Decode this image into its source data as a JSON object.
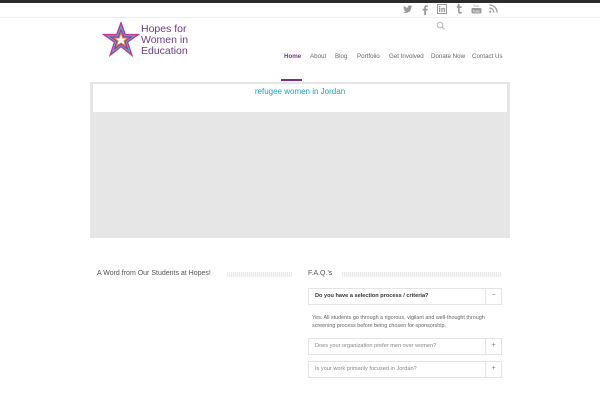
{
  "social_icons": [
    "twitter-icon",
    "facebook-icon",
    "linkedin-icon",
    "tumblr-icon",
    "youtube-icon",
    "rss-icon"
  ],
  "logo": {
    "line1": "Hopes for",
    "line2": "Women in",
    "line3": "Education"
  },
  "nav": [
    "Home",
    "About",
    "Blog",
    "Portfolio",
    "Get Involved",
    "Donate Now",
    "Contact Us"
  ],
  "slider": {
    "caption": "refugee women in Jordan"
  },
  "students": {
    "title": "A Word from Our Students at Hopes!"
  },
  "faq": {
    "title": "F.A.Q.'s",
    "items": [
      {
        "question": "Do you have a selection process / criteria?",
        "toggle": "−",
        "answer": "Yes. All students go through a rigorous, vigilant and well-thought through screening process before being chosen for sponsorship."
      },
      {
        "question": "Does your organization prefer men over women?",
        "toggle": "+"
      },
      {
        "question": "Is your work primarily focused in Jordan?",
        "toggle": "+"
      }
    ]
  },
  "colors": {
    "brand": "#7b2f89",
    "caption": "#1f9fc4"
  }
}
